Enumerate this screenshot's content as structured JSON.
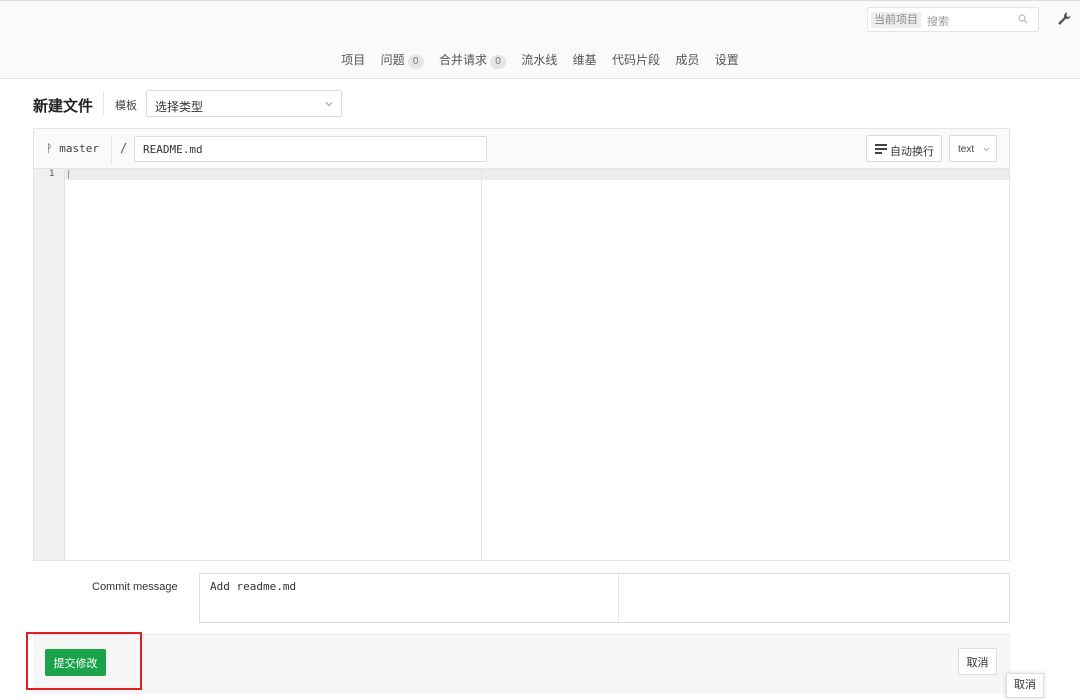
{
  "header": {
    "search": {
      "scope": "当前项目",
      "placeholder": "搜索"
    },
    "nav": [
      {
        "label": "项目"
      },
      {
        "label": "问题",
        "count": "0"
      },
      {
        "label": "合并请求",
        "count": "0"
      },
      {
        "label": "流水线"
      },
      {
        "label": "维基"
      },
      {
        "label": "代码片段"
      },
      {
        "label": "成员"
      },
      {
        "label": "设置"
      }
    ]
  },
  "page": {
    "title": "新建文件",
    "template_label": "模板",
    "template_value": "选择类型"
  },
  "editor": {
    "branch": "master",
    "path_sep": "/",
    "file_name": "README.md",
    "wrap_label": "自动换行",
    "language": "text",
    "line_number": "1"
  },
  "commit": {
    "label": "Commit message",
    "value": "Add readme.md"
  },
  "actions": {
    "submit_label": "提交修改",
    "cancel_label": "取消",
    "tooltip_cancel": "取消"
  },
  "colors": {
    "submit_bg": "#1aa34a",
    "highlight_border": "#e02020"
  },
  "icons": [
    "search-icon",
    "wrench-icon",
    "chevron-down-icon",
    "branch-icon",
    "wrap-icon"
  ]
}
